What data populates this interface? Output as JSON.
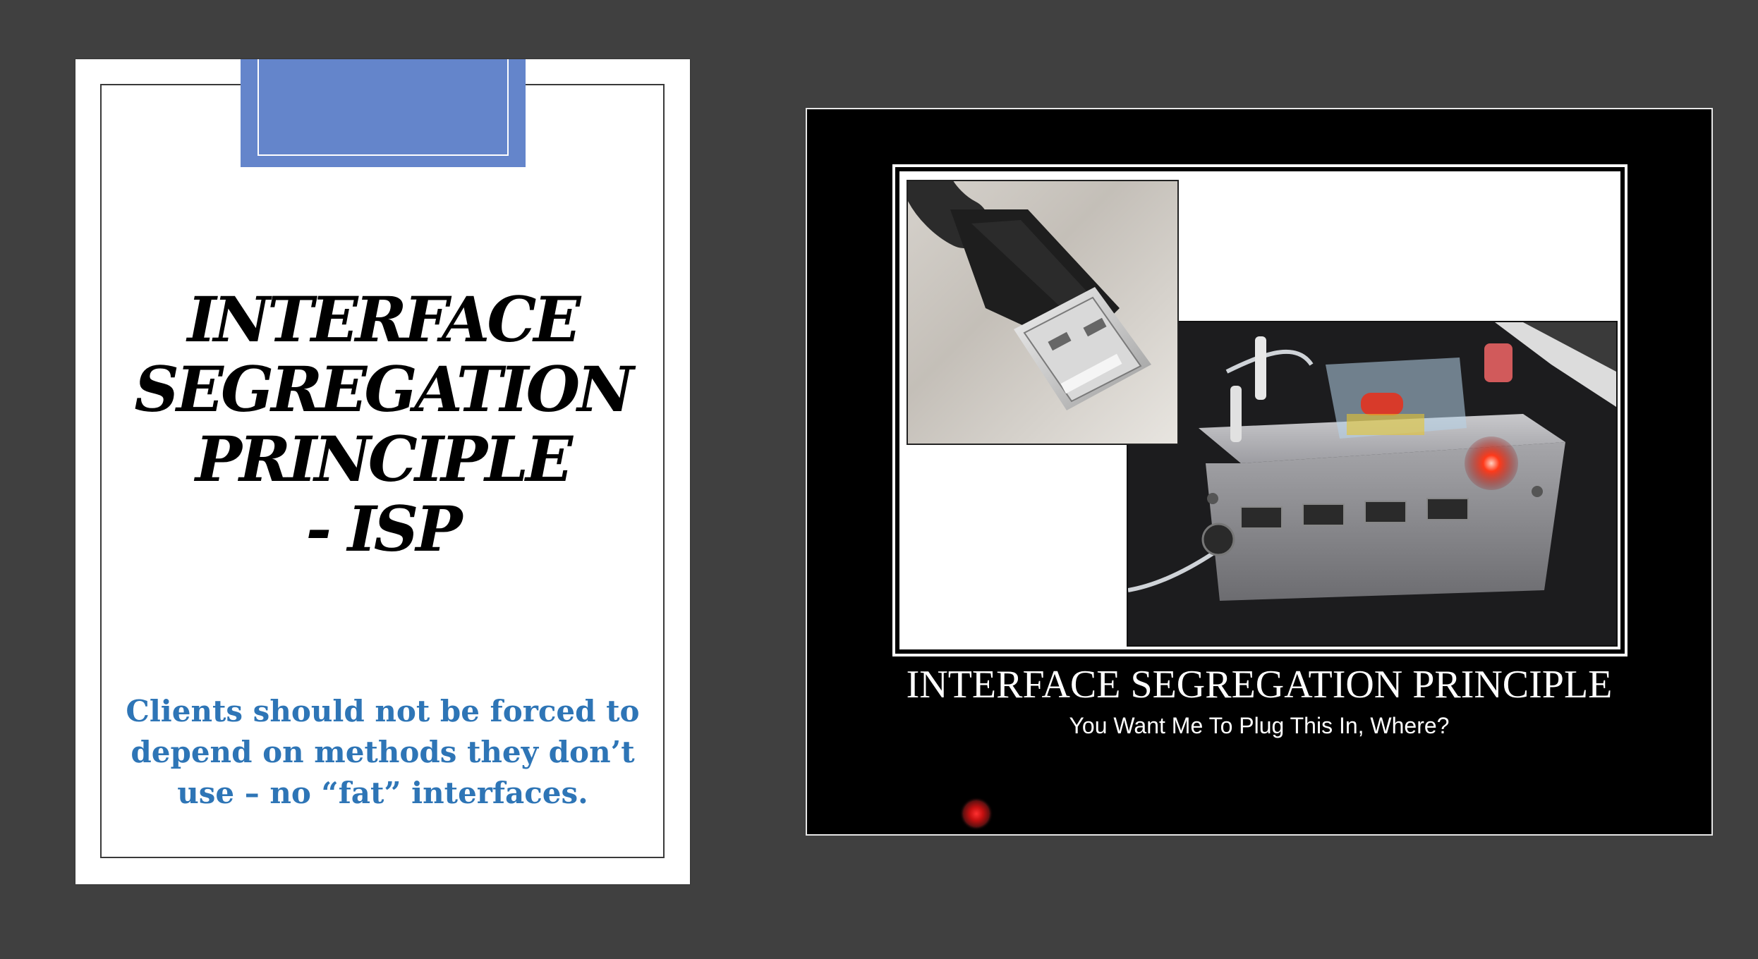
{
  "left_slide": {
    "title_lines": [
      "INTERFACE",
      "SEGREGATION",
      "PRINCIPLE",
      "- ISP"
    ],
    "subtitle": "Clients should not be forced to depend on methods they don’t use – no “fat” interfaces.",
    "colors": {
      "accent_tab": "#6485cb",
      "subtitle": "#2e75b6"
    }
  },
  "right_slide": {
    "poster_title": "INTERFACE SEGREGATION PRINCIPLE",
    "poster_caption": "You Want Me To Plug This In, Where?",
    "images": [
      "usb-plug-photo",
      "usb-hub-device-photo"
    ],
    "pointer": "laser-pointer-dot"
  },
  "colors": {
    "background": "#404040"
  }
}
